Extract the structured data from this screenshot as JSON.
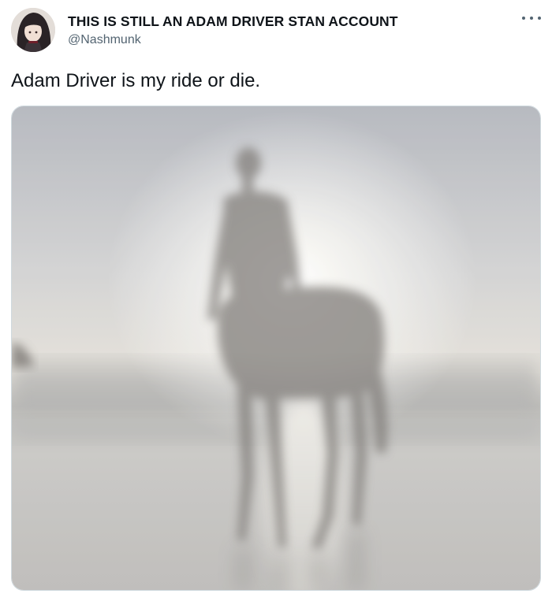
{
  "tweet": {
    "author": {
      "display_name": "THIS IS STILL AN ADAM DRIVER STAN ACCOUNT",
      "handle": "@Nashmunk",
      "avatar_icon": "anime-avatar"
    },
    "text": "Adam Driver is my ride or die.",
    "media": {
      "kind": "photo",
      "subject": "centaur-silhouette-on-beach"
    },
    "more_icon": "more-options-icon"
  },
  "colors": {
    "text_primary": "#0f1419",
    "text_secondary": "#536471",
    "media_border": "#cfd9de"
  }
}
